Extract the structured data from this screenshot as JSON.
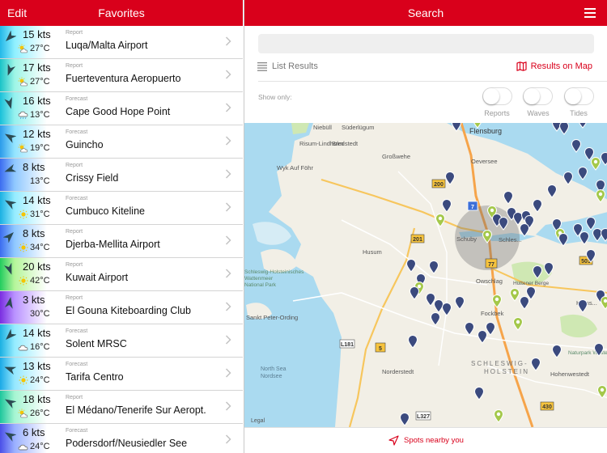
{
  "left_header": {
    "edit_label": "Edit",
    "title": "Favorites"
  },
  "spots": [
    {
      "kts": "15 kts",
      "temp": "27°C",
      "weather": "sun-cloud-icon",
      "kind": "Report",
      "name": "Luqa/Malta Airport",
      "dir": 225,
      "c1": "#23b8e8",
      "c2": "#8ff0ff"
    },
    {
      "kts": "17 kts",
      "temp": "27°C",
      "weather": "sun-cloud-icon",
      "kind": "Report",
      "name": "Fuerteventura Aeropuerto",
      "dir": 200,
      "c1": "#19c3c7",
      "c2": "#9ef5e6"
    },
    {
      "kts": "16 kts",
      "temp": "13°C",
      "weather": "cloud-rain-icon",
      "kind": "Forecast",
      "name": "Cape Good Hope Point",
      "dir": 165,
      "c1": "#18c0d9",
      "c2": "#95f1ee"
    },
    {
      "kts": "12 kts",
      "temp": "19°C",
      "weather": "sun-cloud-icon",
      "kind": "Forecast",
      "name": "Guincho",
      "dir": 300,
      "c1": "#2a9bea",
      "c2": "#93e4ff"
    },
    {
      "kts": "8 kts",
      "temp": "13°C",
      "weather": "none",
      "kind": "Report",
      "name": "Crissy Field",
      "dir": 250,
      "c1": "#3b6cf0",
      "c2": "#8fc8ff"
    },
    {
      "kts": "14 kts",
      "temp": "31°C",
      "weather": "sun-icon",
      "kind": "Forecast",
      "name": "Cumbuco Kiteline",
      "dir": 300,
      "c1": "#1ab0e2",
      "c2": "#95ecff"
    },
    {
      "kts": "8 kts",
      "temp": "34°C",
      "weather": "sun-icon",
      "kind": "Report",
      "name": "Djerba-Mellita Airport",
      "dir": 45,
      "c1": "#3b6cf0",
      "c2": "#8fc8ff"
    },
    {
      "kts": "20 kts",
      "temp": "42°C",
      "weather": "sun-icon",
      "kind": "Report",
      "name": "Kuwait Airport",
      "dir": 160,
      "c1": "#22cc5e",
      "c2": "#b5f59a"
    },
    {
      "kts": "3 kts",
      "temp": "30°C",
      "weather": "none",
      "kind": "Report",
      "name": "El Gouna Kiteboarding Club",
      "dir": 10,
      "c1": "#7a2de0",
      "c2": "#b992ff"
    },
    {
      "kts": "14 kts",
      "temp": "16°C",
      "weather": "cloud-icon",
      "kind": "Forecast",
      "name": "Solent MRSC",
      "dir": 225,
      "c1": "#1ab0e2",
      "c2": "#95ecff"
    },
    {
      "kts": "13 kts",
      "temp": "24°C",
      "weather": "sun-icon",
      "kind": "Forecast",
      "name": "Tarifa Centro",
      "dir": 290,
      "c1": "#1aa9e6",
      "c2": "#95e8ff"
    },
    {
      "kts": "18 kts",
      "temp": "26°C",
      "weather": "sun-cloud-icon",
      "kind": "Report",
      "name": "El Médano/Tenerife Sur Aeropt.",
      "dir": 300,
      "c1": "#1dc69c",
      "c2": "#a6f5d2"
    },
    {
      "kts": "6 kts",
      "temp": "24°C",
      "weather": "cloud-icon",
      "kind": "Forecast",
      "name": "Podersdorf/Neusiedler See",
      "dir": 300,
      "c1": "#4a4fe8",
      "c2": "#9ab0ff"
    }
  ],
  "right_header": {
    "title": "Search"
  },
  "search": {
    "placeholder": "",
    "value": ""
  },
  "view_modes": {
    "list": "List Results",
    "map": "Results on Map"
  },
  "filters": {
    "show_only": "Show only:",
    "toggles": [
      "Reports",
      "Waves",
      "Tides"
    ]
  },
  "map": {
    "legal": "Legal",
    "places": [
      "Flensburg",
      "Niebüll",
      "Großwehe",
      "Oeversee",
      "Süderlügum",
      "Risum-Lindholm",
      "Wyk Auf Föhr",
      "Husum",
      "Schuby",
      "Schleswig",
      "Owschlag",
      "Hüttener Berge",
      "Fockbek",
      "Bredstedt",
      "Schleswig-Holsteinisches Wattenmeer National Park",
      "Sankt Peter-Ording",
      "Hohenwestedt",
      "Kronsh.",
      "Naturpark Westensee",
      "Norderstedt",
      "SCHLESWIG-HOLSTEIN",
      "North Sea",
      "Nordsee"
    ],
    "roads": [
      "200",
      "201",
      "7",
      "77",
      "L181",
      "5",
      "430",
      "L327",
      "503"
    ],
    "colors": {
      "water": "#aadaf0",
      "land": "#f2efe6",
      "green": "#cfe8b3",
      "marker_report": "#3b4a7e",
      "marker_forecast": "#a4c84a"
    }
  },
  "bottom": {
    "label": "Spots nearby you"
  },
  "accent": "#d9001b"
}
